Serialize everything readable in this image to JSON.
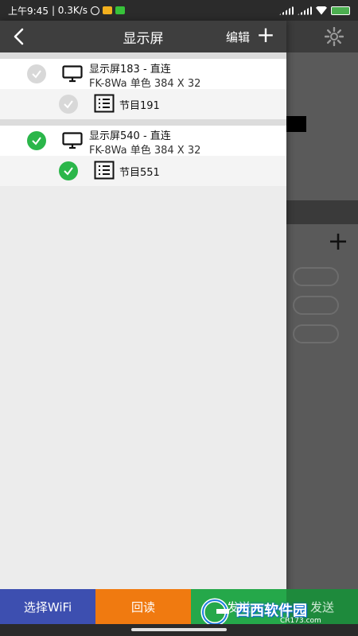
{
  "status_bar": {
    "time": "上午9:45",
    "speed": "| 0.3K/s"
  },
  "header": {
    "title": "显示屏",
    "edit_label": "编辑",
    "add_label": "+"
  },
  "screens": [
    {
      "name": "显示屏183 - 直连",
      "info": "FK-8Wa   单色   384 X 32",
      "selected": false,
      "programs": [
        {
          "name": "节目191",
          "selected": false
        }
      ]
    },
    {
      "name": "显示屏540 - 直连",
      "info": "FK-8Wa   单色   384 X 32",
      "selected": true,
      "programs": [
        {
          "name": "节目551",
          "selected": true
        }
      ]
    }
  ],
  "background": {
    "plus_label": "+"
  },
  "buttons": {
    "select_wifi": "选择WiFi",
    "readback": "回读",
    "send": "发送",
    "send2": "发送"
  },
  "watermark": {
    "brand": "西西软件园",
    "site": "CR173.com"
  },
  "colors": {
    "accent_green": "#2bb64a",
    "wifi_blue": "#3d4fb0",
    "readback_orange": "#f07a10"
  }
}
